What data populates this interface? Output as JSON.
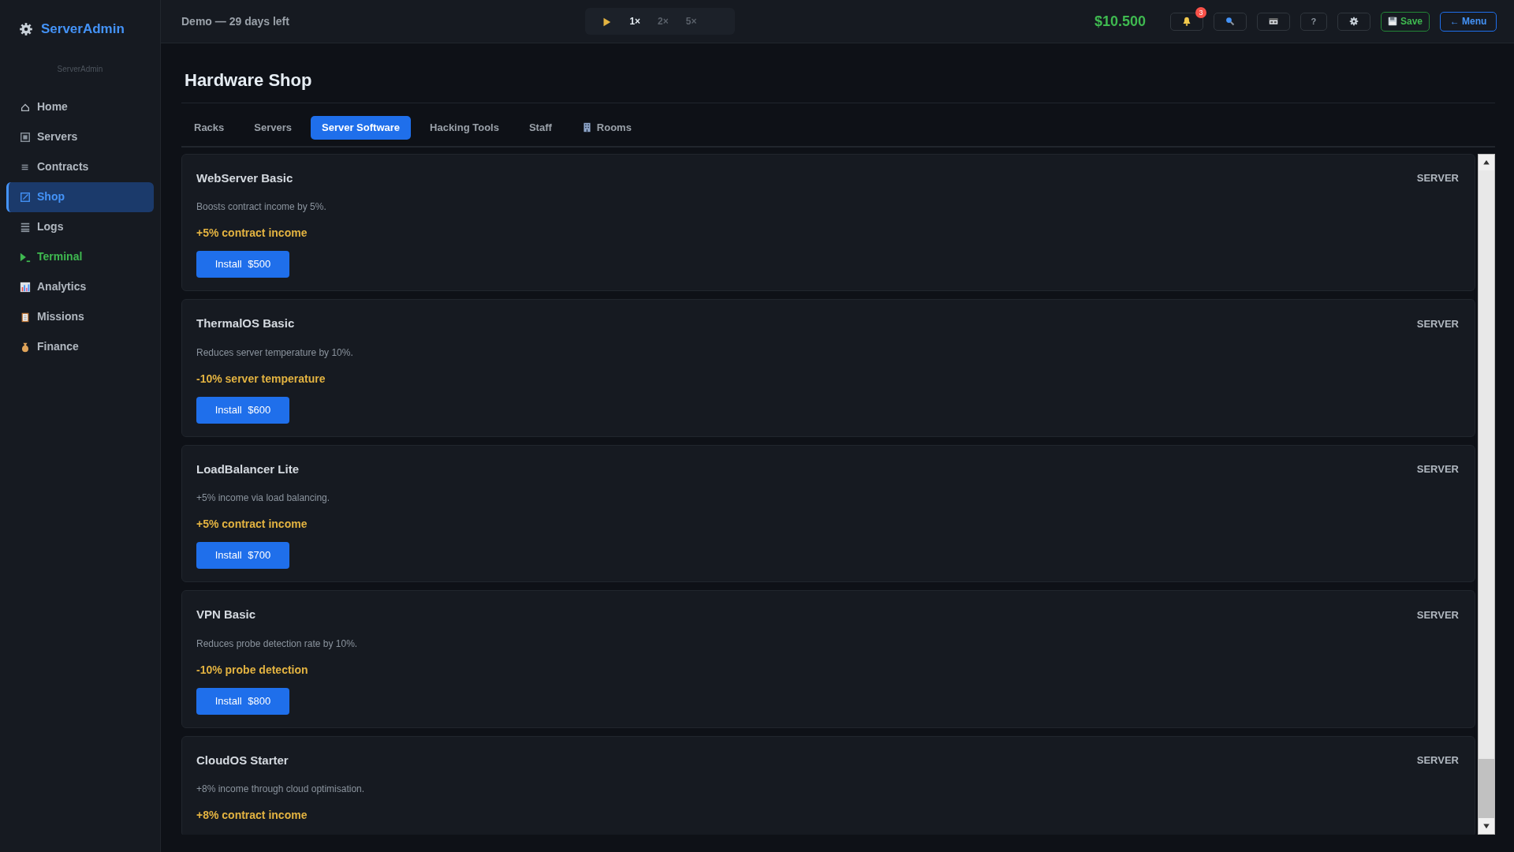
{
  "sidebar": {
    "brand": "ServerAdmin",
    "subtitle": "ServerAdmin",
    "items": [
      {
        "label": "Home",
        "selected": false,
        "color": "#b1b8c0"
      },
      {
        "label": "Servers",
        "selected": false,
        "color": "#b1b8c0"
      },
      {
        "label": "Contracts",
        "selected": false,
        "color": "#b1b8c0"
      },
      {
        "label": "Shop",
        "selected": true,
        "color": "#4493f8"
      },
      {
        "label": "Logs",
        "selected": false,
        "color": "#b1b8c0"
      },
      {
        "label": "Terminal",
        "selected": false,
        "color": "#3fb950"
      },
      {
        "label": "Analytics",
        "selected": false,
        "color": "#b1b8c0"
      },
      {
        "label": "Missions",
        "selected": false,
        "color": "#b1b8c0"
      },
      {
        "label": "Finance",
        "selected": false,
        "color": "#b1b8c0"
      }
    ]
  },
  "topbar": {
    "demo": "Demo — 29 days left",
    "speeds": [
      {
        "label": "1×",
        "selected": true,
        "disabled": false
      },
      {
        "label": "2×",
        "selected": false,
        "disabled": true
      },
      {
        "label": "5×",
        "selected": false,
        "disabled": true
      }
    ],
    "money": "$10.500",
    "notifications": "3",
    "help": "?",
    "save": "Save",
    "menu": "← Menu"
  },
  "page": {
    "title": "Hardware Shop"
  },
  "tabs": [
    {
      "label": "Racks",
      "selected": false,
      "icon": false
    },
    {
      "label": "Servers",
      "selected": false,
      "icon": false
    },
    {
      "label": "Server Software",
      "selected": true,
      "icon": false
    },
    {
      "label": "Hacking Tools",
      "selected": false,
      "icon": false
    },
    {
      "label": "Staff",
      "selected": false,
      "icon": false
    },
    {
      "label": "Rooms",
      "selected": false,
      "icon": true
    }
  ],
  "items": [
    {
      "name": "WebServer Basic",
      "category": "SERVER",
      "description": "Boosts contract income by 5%.",
      "effect": "+5% contract income",
      "action": "Install",
      "price": "$500"
    },
    {
      "name": "ThermalOS Basic",
      "category": "SERVER",
      "description": "Reduces server temperature by 10%.",
      "effect": "-10% server temperature",
      "action": "Install",
      "price": "$600"
    },
    {
      "name": "LoadBalancer Lite",
      "category": "SERVER",
      "description": "+5% income via load balancing.",
      "effect": "+5% contract income",
      "action": "Install",
      "price": "$700"
    },
    {
      "name": "VPN Basic",
      "category": "SERVER",
      "description": "Reduces probe detection rate by 10%.",
      "effect": "-10% probe detection",
      "action": "Install",
      "price": "$800"
    },
    {
      "name": "CloudOS Starter",
      "category": "SERVER",
      "description": "+8% income through cloud optimisation.",
      "effect": "+8% contract income"
    }
  ]
}
